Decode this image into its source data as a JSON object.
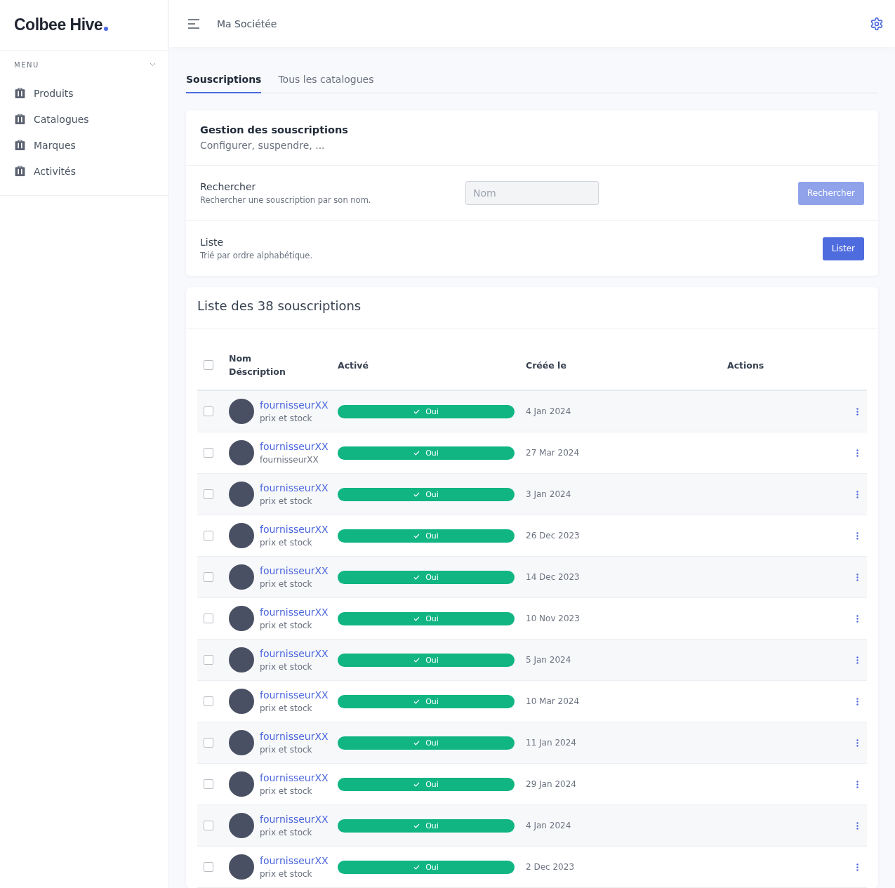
{
  "sidebar": {
    "logo": "Colbee Hive",
    "menu_label": "MENU",
    "items": [
      {
        "label": "Produits"
      },
      {
        "label": "Catalogues"
      },
      {
        "label": "Marques"
      },
      {
        "label": "Activités"
      }
    ]
  },
  "header": {
    "company": "Ma Sociétée"
  },
  "tabs": [
    {
      "label": "Souscriptions",
      "selected": true
    },
    {
      "label": "Tous les catalogues",
      "selected": false
    }
  ],
  "management": {
    "title": "Gestion des souscriptions",
    "subtitle": "Configurer, suspendre, ...",
    "search": {
      "title": "Rechercher",
      "description": "Rechercher une souscription par son nom.",
      "placeholder": "Nom",
      "button": "Rechercher",
      "disabled": true
    },
    "list": {
      "title": "Liste",
      "description": "Trié par ordre alphabétique.",
      "button": "Lister"
    }
  },
  "table": {
    "title": "Liste des 38 souscriptions",
    "select_all_checked": false,
    "columns": {
      "name": "Nom",
      "description": "Déscription",
      "active": "Activé",
      "created": "Créée le",
      "actions": "Actions"
    },
    "rows": [
      {
        "name": "fournisseurXX",
        "description": "prix et stock",
        "active": true,
        "status": "Oui",
        "created": "4 Jan 2024",
        "checked": false
      },
      {
        "name": "fournisseurXX",
        "description": "fournisseurXX",
        "active": true,
        "status": "Oui",
        "created": "27 Mar 2024",
        "checked": false
      },
      {
        "name": "fournisseurXX",
        "description": "prix et stock",
        "active": true,
        "status": "Oui",
        "created": "3 Jan 2024",
        "checked": false
      },
      {
        "name": "fournisseurXX",
        "description": "prix et stock",
        "active": true,
        "status": "Oui",
        "created": "26 Dec 2023",
        "checked": false
      },
      {
        "name": "fournisseurXX",
        "description": "prix et stock",
        "active": true,
        "status": "Oui",
        "created": "14 Dec 2023",
        "checked": false
      },
      {
        "name": "fournisseurXX",
        "description": "prix et stock",
        "active": true,
        "status": "Oui",
        "created": "10 Nov 2023",
        "checked": false
      },
      {
        "name": "fournisseurXX",
        "description": "prix et stock",
        "active": true,
        "status": "Oui",
        "created": "5 Jan 2024",
        "checked": false
      },
      {
        "name": "fournisseurXX",
        "description": "prix et stock",
        "active": true,
        "status": "Oui",
        "created": "10 Mar 2024",
        "checked": false
      },
      {
        "name": "fournisseurXX",
        "description": "prix et stock",
        "active": true,
        "status": "Oui",
        "created": "11 Jan 2024",
        "checked": false
      },
      {
        "name": "fournisseurXX",
        "description": "prix et stock",
        "active": true,
        "status": "Oui",
        "created": "29 Jan 2024",
        "checked": false
      },
      {
        "name": "fournisseurXX",
        "description": "prix et stock",
        "active": true,
        "status": "Oui",
        "created": "4 Jan 2024",
        "checked": false
      },
      {
        "name": "fournisseurXX",
        "description": "prix et stock",
        "active": true,
        "status": "Oui",
        "created": "2 Dec 2023",
        "checked": false
      }
    ]
  }
}
